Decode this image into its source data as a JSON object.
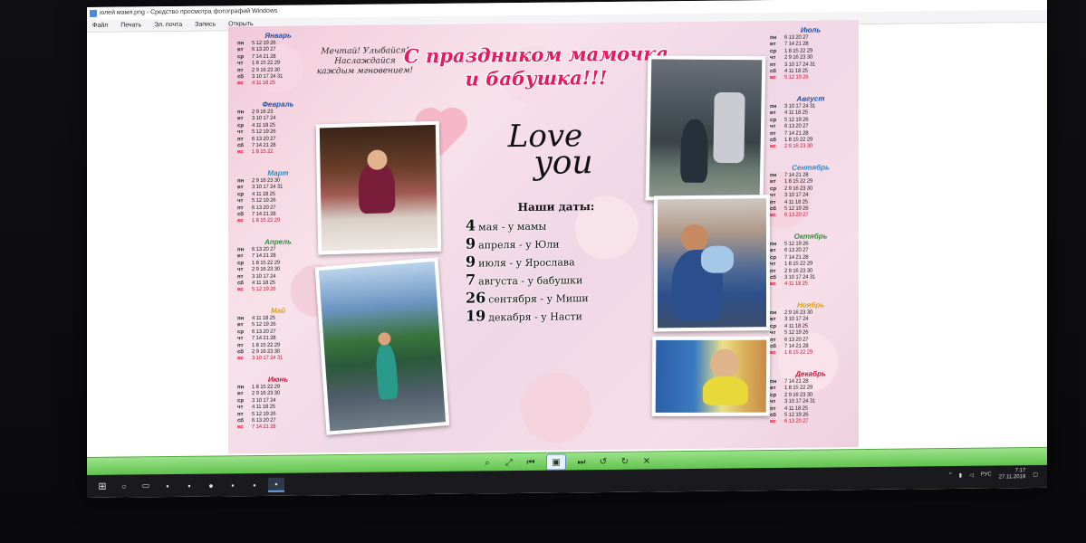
{
  "window": {
    "title": "юлей мамя.png - Средство просмотра фотографий Windows"
  },
  "menu": [
    "Файл",
    "Печать",
    "Эл. почта",
    "Запись",
    "Открыть"
  ],
  "poster": {
    "title_line1": "С праздником мамочка",
    "title_line2": "и бабушка!!!",
    "motto_lines": [
      "Мечтай! Улыбайся! Наслаждайся",
      "каждым мгновением!"
    ],
    "love": "Love",
    "you": "you",
    "dates_title": "Наши даты:",
    "dates": [
      {
        "num": "4",
        "text": "мая - у мамы"
      },
      {
        "num": "9",
        "text": "апреля - у Юли"
      },
      {
        "num": "9",
        "text": "июля - у Ярослава"
      },
      {
        "num": "7",
        "text": "августа - у бабушки"
      },
      {
        "num": "26",
        "text": "сентября - у Миши"
      },
      {
        "num": "19",
        "text": "декабря - у Насти"
      }
    ]
  },
  "calendar_left": [
    {
      "name": "Январь",
      "color": "#1e4fa8",
      "rows": [
        [
          "пн",
          "5 12 19 26"
        ],
        [
          "вт",
          "6 13 20 27"
        ],
        [
          "ср",
          "7 14 21 28"
        ],
        [
          "чт",
          "1 8 15 22 29"
        ],
        [
          "пт",
          "2 9 16 23 30"
        ],
        [
          "сб",
          "3 10 17 24 31"
        ],
        [
          "вс",
          "4 11 18 25"
        ]
      ]
    },
    {
      "name": "Февраль",
      "color": "#1e4fa8",
      "rows": [
        [
          "пн",
          "2 9 16 23"
        ],
        [
          "вт",
          "3 10 17 24"
        ],
        [
          "ср",
          "4 11 18 25"
        ],
        [
          "чт",
          "5 12 19 26"
        ],
        [
          "пт",
          "6 13 20 27"
        ],
        [
          "сб",
          "7 14 21 28"
        ],
        [
          "вс",
          "1 8 15 22"
        ]
      ]
    },
    {
      "name": "Март",
      "color": "#2a8bc9",
      "rows": [
        [
          "пн",
          "2 9 16 23 30"
        ],
        [
          "вт",
          "3 10 17 24 31"
        ],
        [
          "ср",
          "4 11 18 25"
        ],
        [
          "чт",
          "5 12 19 26"
        ],
        [
          "пт",
          "6 13 20 27"
        ],
        [
          "сб",
          "7 14 21 28"
        ],
        [
          "вс",
          "1 8 15 22 29"
        ]
      ]
    },
    {
      "name": "Апрель",
      "color": "#2e8b3a",
      "rows": [
        [
          "пн",
          "6 13 20 27"
        ],
        [
          "вт",
          "7 14 21 28"
        ],
        [
          "ср",
          "1 8 15 22 29"
        ],
        [
          "чт",
          "2 9 16 23 30"
        ],
        [
          "пт",
          "3 10 17 24"
        ],
        [
          "сб",
          "4 11 18 25"
        ],
        [
          "вс",
          "5 12 19 26"
        ]
      ]
    },
    {
      "name": "Май",
      "color": "#d8a21a",
      "rows": [
        [
          "пн",
          "4 11 18 25"
        ],
        [
          "вт",
          "5 12 19 26"
        ],
        [
          "ср",
          "6 13 20 27"
        ],
        [
          "чт",
          "7 14 21 28"
        ],
        [
          "пт",
          "1 8 15 22 29"
        ],
        [
          "сб",
          "2 9 16 23 30"
        ],
        [
          "вс",
          "3 10 17 24 31"
        ]
      ]
    },
    {
      "name": "Июнь",
      "color": "#c0193a",
      "rows": [
        [
          "пн",
          "1 8 15 22 29"
        ],
        [
          "вт",
          "2 9 16 23 30"
        ],
        [
          "ср",
          "3 10 17 24"
        ],
        [
          "чт",
          "4 11 18 25"
        ],
        [
          "пт",
          "5 12 19 26"
        ],
        [
          "сб",
          "6 13 20 27"
        ],
        [
          "вс",
          "7 14 21 28"
        ]
      ]
    }
  ],
  "calendar_right": [
    {
      "name": "Июль",
      "color": "#1e4fa8",
      "rows": [
        [
          "пн",
          "6 13 20 27"
        ],
        [
          "вт",
          "7 14 21 28"
        ],
        [
          "ср",
          "1 8 15 22 29"
        ],
        [
          "чт",
          "2 9 16 23 30"
        ],
        [
          "пт",
          "3 10 17 24 31"
        ],
        [
          "сб",
          "4 11 18 25"
        ],
        [
          "вс",
          "5 12 19 26"
        ]
      ]
    },
    {
      "name": "Август",
      "color": "#1e4fa8",
      "rows": [
        [
          "пн",
          "3 10 17 24 31"
        ],
        [
          "вт",
          "4 11 18 25"
        ],
        [
          "ср",
          "5 12 19 26"
        ],
        [
          "чт",
          "6 13 20 27"
        ],
        [
          "пт",
          "7 14 21 28"
        ],
        [
          "сб",
          "1 8 15 22 29"
        ],
        [
          "вс",
          "2 9 16 23 30"
        ]
      ]
    },
    {
      "name": "Сентябрь",
      "color": "#2a8bc9",
      "rows": [
        [
          "пн",
          "7 14 21 28"
        ],
        [
          "вт",
          "1 8 15 22 29"
        ],
        [
          "ср",
          "2 9 16 23 30"
        ],
        [
          "чт",
          "3 10 17 24"
        ],
        [
          "пт",
          "4 11 18 25"
        ],
        [
          "сб",
          "5 12 19 26"
        ],
        [
          "вс",
          "6 13 20 27"
        ]
      ]
    },
    {
      "name": "Октябрь",
      "color": "#2e8b3a",
      "rows": [
        [
          "пн",
          "5 12 19 26"
        ],
        [
          "вт",
          "6 13 20 27"
        ],
        [
          "ср",
          "7 14 21 28"
        ],
        [
          "чт",
          "1 8 15 22 29"
        ],
        [
          "пт",
          "2 9 16 23 30"
        ],
        [
          "сб",
          "3 10 17 24 31"
        ],
        [
          "вс",
          "4 11 18 25"
        ]
      ]
    },
    {
      "name": "Ноябрь",
      "color": "#d8a21a",
      "rows": [
        [
          "пн",
          "2 9 16 23 30"
        ],
        [
          "вт",
          "3 10 17 24"
        ],
        [
          "ср",
          "4 11 18 25"
        ],
        [
          "чт",
          "5 12 19 26"
        ],
        [
          "пт",
          "6 13 20 27"
        ],
        [
          "сб",
          "7 14 21 28"
        ],
        [
          "вс",
          "1 8 15 22 29"
        ]
      ]
    },
    {
      "name": "Декабрь",
      "color": "#c0193a",
      "rows": [
        [
          "пн",
          "7 14 21 28"
        ],
        [
          "вт",
          "1 8 15 22 29"
        ],
        [
          "ср",
          "2 9 16 23 30"
        ],
        [
          "чт",
          "3 10 17 24 31"
        ],
        [
          "пт",
          "4 11 18 25"
        ],
        [
          "сб",
          "5 12 19 26"
        ],
        [
          "вс",
          "6 13 20 27"
        ]
      ]
    }
  ],
  "viewer_toolbar": [
    "zoom-icon",
    "fit-icon",
    "prev-icon",
    "slideshow-icon",
    "next-icon",
    "rotate-left-icon",
    "rotate-right-icon",
    "delete-icon"
  ],
  "taskbar": {
    "lang": "РУС",
    "time": "7:17",
    "date": "27.11.2019"
  }
}
